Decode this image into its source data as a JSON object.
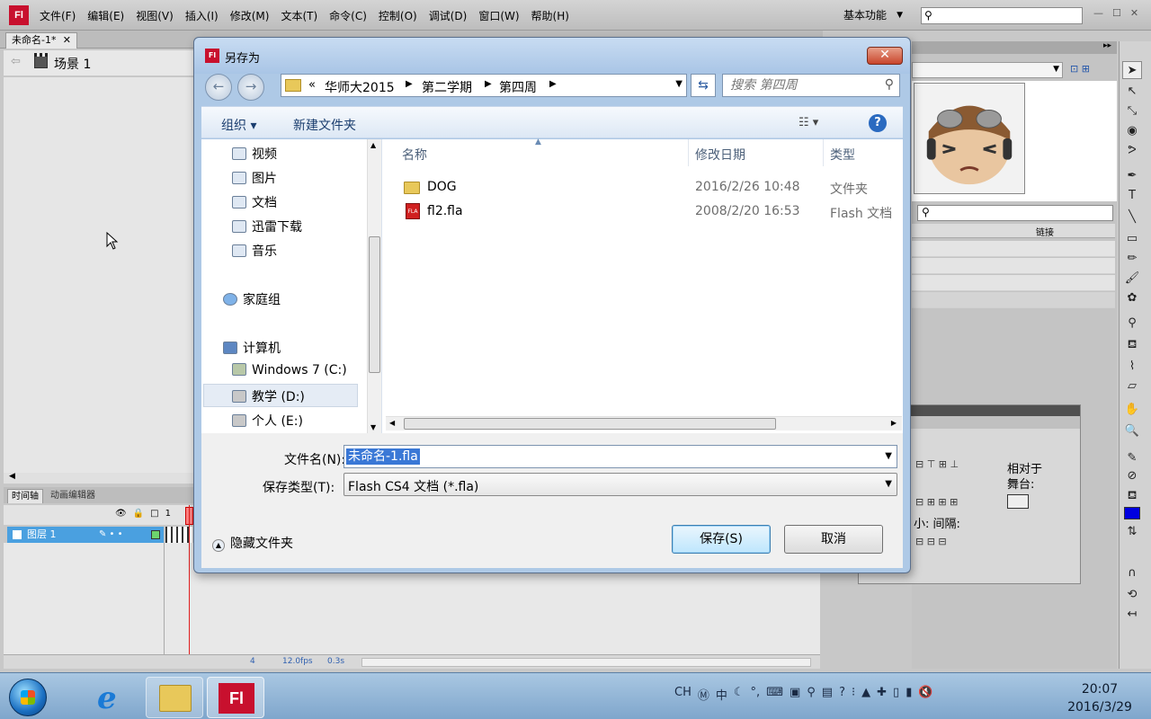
{
  "app": {
    "logo": "Fl",
    "menus": [
      "文件(F)",
      "编辑(E)",
      "视图(V)",
      "插入(I)",
      "修改(M)",
      "文本(T)",
      "命令(C)",
      "控制(O)",
      "调试(D)",
      "窗口(W)",
      "帮助(H)"
    ],
    "workspace": "基本功能",
    "doc_tab": "未命名-1*",
    "scene": "场景 1",
    "timeline_tabs": [
      "时间轴",
      "动画编辑器"
    ],
    "layer_name": "图层 1",
    "frame_marker": "1",
    "status": {
      "frame": "4",
      "fps": "12.0fps",
      "time": "0.3s"
    },
    "library_link_col": "链接",
    "align": {
      "relative_to": "相对于\n舞台:",
      "spacing": "小:  间隔:"
    }
  },
  "dialog": {
    "title": "另存为",
    "breadcrumbs": [
      "华师大2015",
      "第二学期",
      "第四周"
    ],
    "breadcrumb_prefix": "«",
    "search_placeholder": "搜索 第四周",
    "toolbar": {
      "organize": "组织 ▾",
      "new_folder": "新建文件夹"
    },
    "nav": {
      "items": [
        {
          "label": "视频"
        },
        {
          "label": "图片"
        },
        {
          "label": "文档"
        },
        {
          "label": "迅雷下载"
        },
        {
          "label": "音乐"
        },
        {
          "label": "家庭组"
        },
        {
          "label": "计算机"
        },
        {
          "label": "Windows 7 (C:)"
        },
        {
          "label": "教学 (D:)"
        },
        {
          "label": "个人 (E:)"
        }
      ]
    },
    "columns": {
      "name": "名称",
      "date": "修改日期",
      "type": "类型"
    },
    "files": [
      {
        "name": "DOG",
        "date": "2016/2/26 10:48",
        "type": "文件夹",
        "icon": "folder-icon"
      },
      {
        "name": "fl2.fla",
        "date": "2008/2/20 16:53",
        "type": "Flash 文档",
        "icon": "fla-file-icon"
      }
    ],
    "filename_label": "文件名(N):",
    "filename_value": "未命名-1.fla",
    "filetype_label": "保存类型(T):",
    "filetype_value": "Flash CS4 文档 (*.fla)",
    "hide_folders": "隐藏文件夹",
    "save_button": "保存(S)",
    "cancel_button": "取消"
  },
  "taskbar": {
    "ime": "CH",
    "time": "20:07",
    "date": "2016/3/29"
  },
  "colors": {
    "accent": "#3a78d6",
    "flash_red": "#c8102e"
  }
}
